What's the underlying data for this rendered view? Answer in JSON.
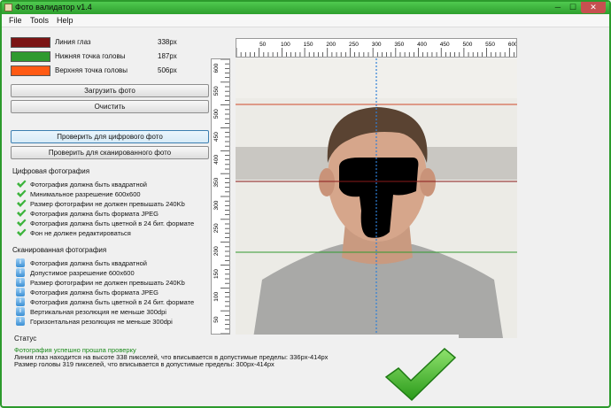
{
  "window": {
    "title": "Фото валидатор v1.4",
    "controls": {
      "minimize": "─",
      "maximize": "☐",
      "close": "✕"
    }
  },
  "menu": [
    "File",
    "Tools",
    "Help"
  ],
  "legend": [
    {
      "label": "Линия глаз",
      "value": "338px",
      "color": "#7b1414"
    },
    {
      "label": "Нижняя точка головы",
      "value": "187px",
      "color": "#2f9a2f"
    },
    {
      "label": "Верхняя точка головы",
      "value": "506px",
      "color": "#ff5a14"
    }
  ],
  "buttons": {
    "load": "Загрузить фото",
    "clear": "Очистить",
    "check_digital": "Проверить для цифрового фото",
    "check_scanned": "Проверить для сканированного фото"
  },
  "digital": {
    "title": "Цифровая фотография",
    "items": [
      "Фотография должна быть квадратной",
      "Минимальное разрешение 600x600",
      "Размер фотографии не должен превышать 240Kb",
      "Фотография должна быть формата JPEG",
      "Фотография должна быть цветной в 24 бит. формате",
      "Фон не должен редактироваться"
    ]
  },
  "scanned": {
    "title": "Сканированная фотография",
    "items": [
      "Фотография должна быть квадратной",
      "Допустимое разрешение 600x600",
      "Размер фотографии не должен превышать 240Kb",
      "Фотография должна быть формата JPEG",
      "Фотография должна быть цветной в 24 бит. формате",
      "Вертикальная резолюция не меньше 300dpi",
      "Горизонтальная резолюция не меньше 300dpi"
    ]
  },
  "ruler": {
    "top_labels": [
      "50",
      "100",
      "150",
      "200",
      "250",
      "300",
      "350",
      "400",
      "450",
      "500",
      "550",
      "600"
    ],
    "left_labels": [
      "600",
      "550",
      "500",
      "450",
      "400",
      "350",
      "300",
      "250",
      "200",
      "150",
      "100",
      "50"
    ]
  },
  "status": {
    "title": "Статус",
    "success": "Фотография успешно прошла проверку",
    "line1": "Линия глаз находится на высоте 338 пикселей, что вписывается в допустимые пределы: 336px-414px",
    "line2": "Размер головы 319 пикселей, что вписывается в допустимые пределы: 300px-414px"
  },
  "colors": {
    "success_text": "#1a8a1a",
    "check_green": "#3cb43c",
    "guide_blue": "#2f7fd6",
    "accent_border": "#2c9a2c"
  },
  "icons": {
    "app": "app-icon",
    "check": "check-icon",
    "info": "info-icon",
    "big_check": "success-checkmark-icon"
  }
}
